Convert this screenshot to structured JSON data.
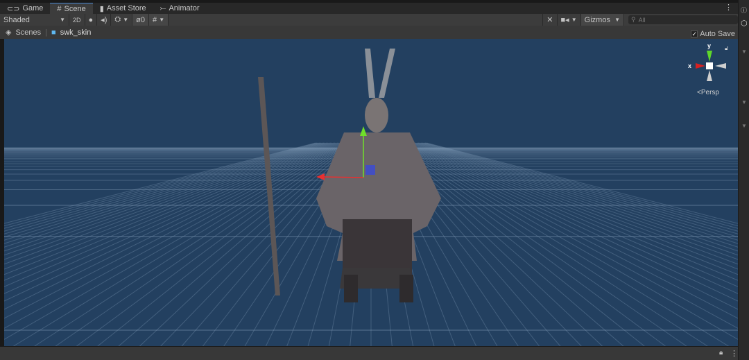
{
  "tabs": [
    {
      "label": "Game",
      "icon": "gamepad-icon"
    },
    {
      "label": "Scene",
      "icon": "grid-icon"
    },
    {
      "label": "Asset Store",
      "icon": "bag-icon"
    },
    {
      "label": "Animator",
      "icon": "animator-icon"
    }
  ],
  "toolbar": {
    "shading_mode": "Shaded",
    "mode_2d": "2D",
    "hidden_count": "0",
    "gizmos": "Gizmos",
    "search_placeholder": "All"
  },
  "breadcrumb": {
    "root": "Scenes",
    "scene": "swk_skin"
  },
  "auto_save": {
    "label": "Auto Save",
    "checked": true
  },
  "gizmo": {
    "y": "y",
    "x": "x",
    "projection": "Persp"
  },
  "colors": {
    "viewport": "#234060",
    "accent": "#4a8ad6"
  }
}
